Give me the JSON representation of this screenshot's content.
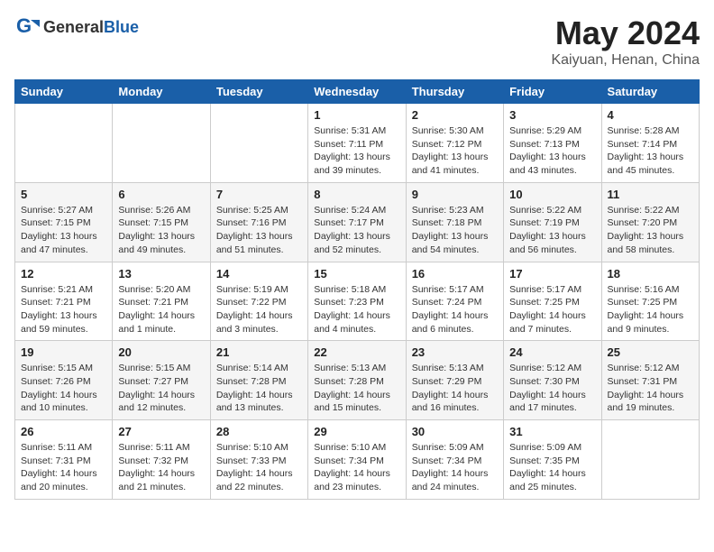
{
  "header": {
    "logo_general": "General",
    "logo_blue": "Blue",
    "month": "May 2024",
    "location": "Kaiyuan, Henan, China"
  },
  "weekdays": [
    "Sunday",
    "Monday",
    "Tuesday",
    "Wednesday",
    "Thursday",
    "Friday",
    "Saturday"
  ],
  "weeks": [
    [
      {
        "day": "",
        "sunrise": "",
        "sunset": "",
        "daylight": ""
      },
      {
        "day": "",
        "sunrise": "",
        "sunset": "",
        "daylight": ""
      },
      {
        "day": "",
        "sunrise": "",
        "sunset": "",
        "daylight": ""
      },
      {
        "day": "1",
        "sunrise": "Sunrise: 5:31 AM",
        "sunset": "Sunset: 7:11 PM",
        "daylight": "Daylight: 13 hours and 39 minutes."
      },
      {
        "day": "2",
        "sunrise": "Sunrise: 5:30 AM",
        "sunset": "Sunset: 7:12 PM",
        "daylight": "Daylight: 13 hours and 41 minutes."
      },
      {
        "day": "3",
        "sunrise": "Sunrise: 5:29 AM",
        "sunset": "Sunset: 7:13 PM",
        "daylight": "Daylight: 13 hours and 43 minutes."
      },
      {
        "day": "4",
        "sunrise": "Sunrise: 5:28 AM",
        "sunset": "Sunset: 7:14 PM",
        "daylight": "Daylight: 13 hours and 45 minutes."
      }
    ],
    [
      {
        "day": "5",
        "sunrise": "Sunrise: 5:27 AM",
        "sunset": "Sunset: 7:15 PM",
        "daylight": "Daylight: 13 hours and 47 minutes."
      },
      {
        "day": "6",
        "sunrise": "Sunrise: 5:26 AM",
        "sunset": "Sunset: 7:15 PM",
        "daylight": "Daylight: 13 hours and 49 minutes."
      },
      {
        "day": "7",
        "sunrise": "Sunrise: 5:25 AM",
        "sunset": "Sunset: 7:16 PM",
        "daylight": "Daylight: 13 hours and 51 minutes."
      },
      {
        "day": "8",
        "sunrise": "Sunrise: 5:24 AM",
        "sunset": "Sunset: 7:17 PM",
        "daylight": "Daylight: 13 hours and 52 minutes."
      },
      {
        "day": "9",
        "sunrise": "Sunrise: 5:23 AM",
        "sunset": "Sunset: 7:18 PM",
        "daylight": "Daylight: 13 hours and 54 minutes."
      },
      {
        "day": "10",
        "sunrise": "Sunrise: 5:22 AM",
        "sunset": "Sunset: 7:19 PM",
        "daylight": "Daylight: 13 hours and 56 minutes."
      },
      {
        "day": "11",
        "sunrise": "Sunrise: 5:22 AM",
        "sunset": "Sunset: 7:20 PM",
        "daylight": "Daylight: 13 hours and 58 minutes."
      }
    ],
    [
      {
        "day": "12",
        "sunrise": "Sunrise: 5:21 AM",
        "sunset": "Sunset: 7:21 PM",
        "daylight": "Daylight: 13 hours and 59 minutes."
      },
      {
        "day": "13",
        "sunrise": "Sunrise: 5:20 AM",
        "sunset": "Sunset: 7:21 PM",
        "daylight": "Daylight: 14 hours and 1 minute."
      },
      {
        "day": "14",
        "sunrise": "Sunrise: 5:19 AM",
        "sunset": "Sunset: 7:22 PM",
        "daylight": "Daylight: 14 hours and 3 minutes."
      },
      {
        "day": "15",
        "sunrise": "Sunrise: 5:18 AM",
        "sunset": "Sunset: 7:23 PM",
        "daylight": "Daylight: 14 hours and 4 minutes."
      },
      {
        "day": "16",
        "sunrise": "Sunrise: 5:17 AM",
        "sunset": "Sunset: 7:24 PM",
        "daylight": "Daylight: 14 hours and 6 minutes."
      },
      {
        "day": "17",
        "sunrise": "Sunrise: 5:17 AM",
        "sunset": "Sunset: 7:25 PM",
        "daylight": "Daylight: 14 hours and 7 minutes."
      },
      {
        "day": "18",
        "sunrise": "Sunrise: 5:16 AM",
        "sunset": "Sunset: 7:25 PM",
        "daylight": "Daylight: 14 hours and 9 minutes."
      }
    ],
    [
      {
        "day": "19",
        "sunrise": "Sunrise: 5:15 AM",
        "sunset": "Sunset: 7:26 PM",
        "daylight": "Daylight: 14 hours and 10 minutes."
      },
      {
        "day": "20",
        "sunrise": "Sunrise: 5:15 AM",
        "sunset": "Sunset: 7:27 PM",
        "daylight": "Daylight: 14 hours and 12 minutes."
      },
      {
        "day": "21",
        "sunrise": "Sunrise: 5:14 AM",
        "sunset": "Sunset: 7:28 PM",
        "daylight": "Daylight: 14 hours and 13 minutes."
      },
      {
        "day": "22",
        "sunrise": "Sunrise: 5:13 AM",
        "sunset": "Sunset: 7:28 PM",
        "daylight": "Daylight: 14 hours and 15 minutes."
      },
      {
        "day": "23",
        "sunrise": "Sunrise: 5:13 AM",
        "sunset": "Sunset: 7:29 PM",
        "daylight": "Daylight: 14 hours and 16 minutes."
      },
      {
        "day": "24",
        "sunrise": "Sunrise: 5:12 AM",
        "sunset": "Sunset: 7:30 PM",
        "daylight": "Daylight: 14 hours and 17 minutes."
      },
      {
        "day": "25",
        "sunrise": "Sunrise: 5:12 AM",
        "sunset": "Sunset: 7:31 PM",
        "daylight": "Daylight: 14 hours and 19 minutes."
      }
    ],
    [
      {
        "day": "26",
        "sunrise": "Sunrise: 5:11 AM",
        "sunset": "Sunset: 7:31 PM",
        "daylight": "Daylight: 14 hours and 20 minutes."
      },
      {
        "day": "27",
        "sunrise": "Sunrise: 5:11 AM",
        "sunset": "Sunset: 7:32 PM",
        "daylight": "Daylight: 14 hours and 21 minutes."
      },
      {
        "day": "28",
        "sunrise": "Sunrise: 5:10 AM",
        "sunset": "Sunset: 7:33 PM",
        "daylight": "Daylight: 14 hours and 22 minutes."
      },
      {
        "day": "29",
        "sunrise": "Sunrise: 5:10 AM",
        "sunset": "Sunset: 7:34 PM",
        "daylight": "Daylight: 14 hours and 23 minutes."
      },
      {
        "day": "30",
        "sunrise": "Sunrise: 5:09 AM",
        "sunset": "Sunset: 7:34 PM",
        "daylight": "Daylight: 14 hours and 24 minutes."
      },
      {
        "day": "31",
        "sunrise": "Sunrise: 5:09 AM",
        "sunset": "Sunset: 7:35 PM",
        "daylight": "Daylight: 14 hours and 25 minutes."
      },
      {
        "day": "",
        "sunrise": "",
        "sunset": "",
        "daylight": ""
      }
    ]
  ]
}
